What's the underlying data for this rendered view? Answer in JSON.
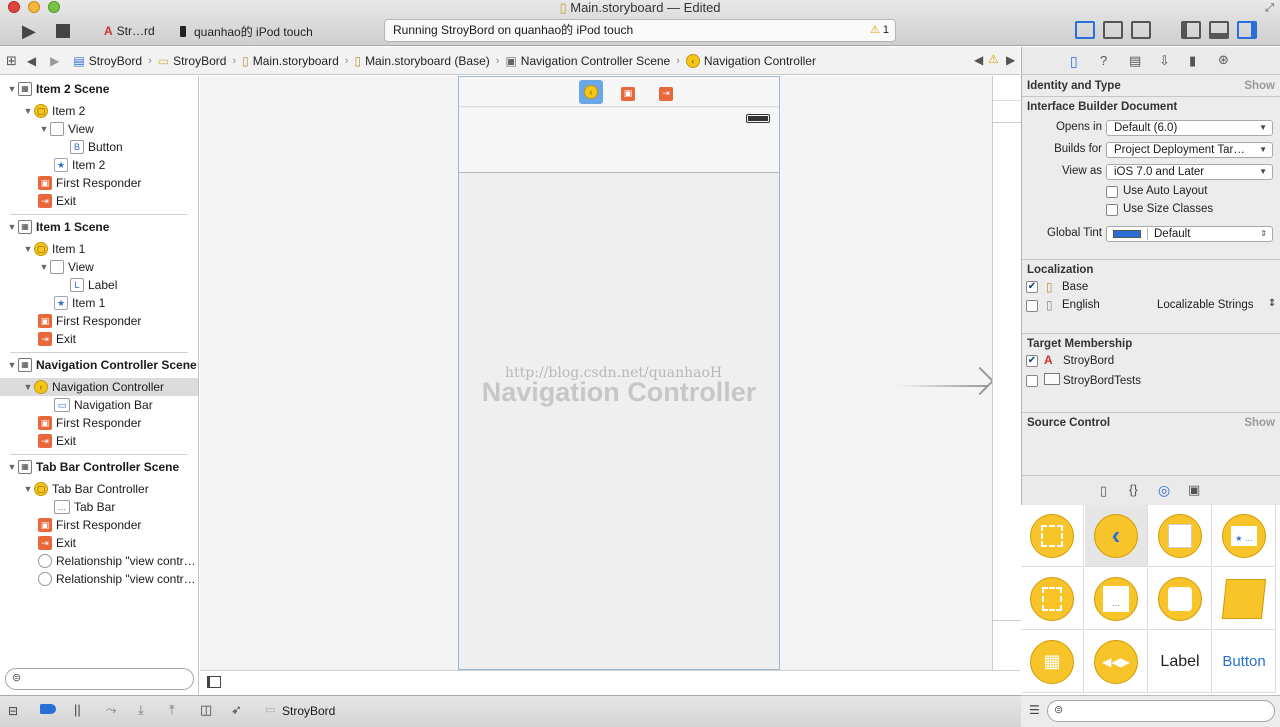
{
  "window": {
    "title": "Main.storyboard — Edited"
  },
  "toolbar": {
    "scheme": "Str…rd",
    "device": "quanhao的 iPod touch",
    "status": "Running StroyBord on quanhao的 iPod touch",
    "warning_count": "1"
  },
  "jumpbar": {
    "crumbs": [
      "StroyBord",
      "StroyBord",
      "Main.storyboard",
      "Main.storyboard (Base)",
      "Navigation Controller Scene",
      "Navigation Controller"
    ]
  },
  "outline": {
    "item2_scene": "Item 2 Scene",
    "item2": "Item 2",
    "view": "View",
    "button": "Button",
    "item2_bar": "Item 2",
    "first_responder": "First Responder",
    "exit": "Exit",
    "item1_scene": "Item 1 Scene",
    "item1": "Item 1",
    "label": "Label",
    "item1_bar": "Item 1",
    "nav_scene": "Navigation Controller Scene",
    "nav_controller": "Navigation Controller",
    "nav_bar": "Navigation Bar",
    "tab_scene": "Tab Bar Controller Scene",
    "tab_controller": "Tab Bar Controller",
    "tab_bar": "Tab Bar",
    "rel1": "Relationship \"view contr…",
    "rel2": "Relationship \"view contr…"
  },
  "canvas": {
    "scene_label": "Navigation Controller",
    "watermark": "http://blog.csdn.net/quanhaoH"
  },
  "inspector": {
    "identity_type": "Identity and Type",
    "show": "Show",
    "ib_document": "Interface Builder Document",
    "opens_in_label": "Opens in",
    "opens_in_value": "Default (6.0)",
    "builds_for_label": "Builds for",
    "builds_for_value": "Project Deployment Tar…",
    "view_as_label": "View as",
    "view_as_value": "iOS 7.0 and Later",
    "auto_layout": "Use Auto Layout",
    "size_classes": "Use Size Classes",
    "global_tint_label": "Global Tint",
    "global_tint_value": "Default",
    "localization": "Localization",
    "loc_base": "Base",
    "loc_english": "English",
    "loc_english_type": "Localizable Strings",
    "target_membership": "Target Membership",
    "target1": "StroyBord",
    "target2": "StroyBordTests",
    "source_control": "Source Control"
  },
  "library": {
    "label_text": "Label",
    "button_text": "Button"
  },
  "bottombar": {
    "target": "StroyBord"
  }
}
